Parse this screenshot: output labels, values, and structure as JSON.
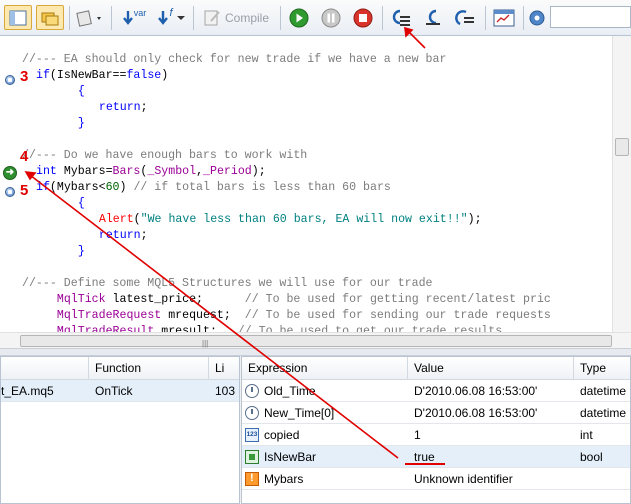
{
  "toolbar": {
    "compile_label": "Compile",
    "var_label": "var",
    "f_label": "f",
    "accent_color": "#1e5fae"
  },
  "editor": {
    "lines": [
      [
        {
          "t": "//--- EA should only check for new trade if we have a new bar",
          "c": "cm"
        }
      ],
      [
        {
          "t": "if",
          "c": "kw"
        },
        {
          "t": "(IsNewBar==",
          "c": "pl"
        },
        {
          "t": "false",
          "c": "kw"
        },
        {
          "t": ")",
          "c": "pl"
        }
      ],
      [
        {
          "t": "  {",
          "c": "kw"
        }
      ],
      [
        {
          "t": "   return",
          "c": "kw"
        },
        {
          "t": ";",
          "c": "pl"
        }
      ],
      [
        {
          "t": "  }",
          "c": "kw"
        }
      ],
      [],
      [
        {
          "t": "//--- Do we have enough bars to work with",
          "c": "cm"
        }
      ],
      [
        {
          "t": "int",
          "c": "kw"
        },
        {
          "t": " Mybars=",
          "c": "pl"
        },
        {
          "t": "Bars",
          "c": "fn"
        },
        {
          "t": "(",
          "c": "pl"
        },
        {
          "t": "_Symbol",
          "c": "ty"
        },
        {
          "t": ",",
          "c": "pl"
        },
        {
          "t": "_Period",
          "c": "ty"
        },
        {
          "t": ");",
          "c": "pl"
        }
      ],
      [
        {
          "t": "if",
          "c": "kw"
        },
        {
          "t": "(Mybars<",
          "c": "pl"
        },
        {
          "t": "60",
          "c": "nu"
        },
        {
          "t": ") ",
          "c": "pl"
        },
        {
          "t": "// if total bars is less than 60 bars",
          "c": "cm"
        }
      ],
      [
        {
          "t": "  {",
          "c": "kw"
        }
      ],
      [
        {
          "t": "   Alert",
          "c": "red"
        },
        {
          "t": "(",
          "c": "pl"
        },
        {
          "t": "\"We have less than 60 bars, EA will now exit!!\"",
          "c": "st"
        },
        {
          "t": ");",
          "c": "pl"
        }
      ],
      [
        {
          "t": "   return",
          "c": "kw"
        },
        {
          "t": ";",
          "c": "pl"
        }
      ],
      [
        {
          "t": "  }",
          "c": "kw"
        }
      ],
      [],
      [
        {
          "t": "//--- Define some MQL5 Structures we will use for our trade",
          "c": "cm"
        }
      ],
      [
        {
          "t": "   MqlTick",
          "c": "ty"
        },
        {
          "t": " latest_price;      ",
          "c": "pl"
        },
        {
          "t": "// To be used for getting recent/latest pric",
          "c": "cm"
        }
      ],
      [
        {
          "t": "   MqlTradeRequest",
          "c": "ty"
        },
        {
          "t": " mrequest;  ",
          "c": "pl"
        },
        {
          "t": "// To be used for sending our trade requests",
          "c": "cm"
        }
      ],
      [
        {
          "t": "   MqlTradeResult",
          "c": "ty"
        },
        {
          "t": " mresult;   ",
          "c": "pl"
        },
        {
          "t": "// To be used to get our trade results",
          "c": "cm"
        }
      ]
    ],
    "annotations": [
      "3",
      "4",
      "5"
    ]
  },
  "callstack": {
    "headers": [
      "",
      "Function",
      "Li"
    ],
    "rows": [
      {
        "file": "t_EA.mq5",
        "function": "OnTick",
        "line": "103"
      }
    ]
  },
  "watch": {
    "headers": [
      "Expression",
      "Value",
      "Type"
    ],
    "rows": [
      {
        "icon": "clock-icon",
        "expression": "Old_Time",
        "value": "D'2010.06.08 16:53:00'",
        "type": "datetime"
      },
      {
        "icon": "clock-icon",
        "expression": "New_Time[0]",
        "value": "D'2010.06.08 16:53:00'",
        "type": "datetime"
      },
      {
        "icon": "number-icon",
        "expression": "copied",
        "value": "1",
        "type": "int"
      },
      {
        "icon": "bool-icon",
        "expression": "IsNewBar",
        "value": "true",
        "type": "bool"
      },
      {
        "icon": "error-icon",
        "expression": "Mybars",
        "value": "Unknown identifier",
        "type": ""
      }
    ]
  }
}
